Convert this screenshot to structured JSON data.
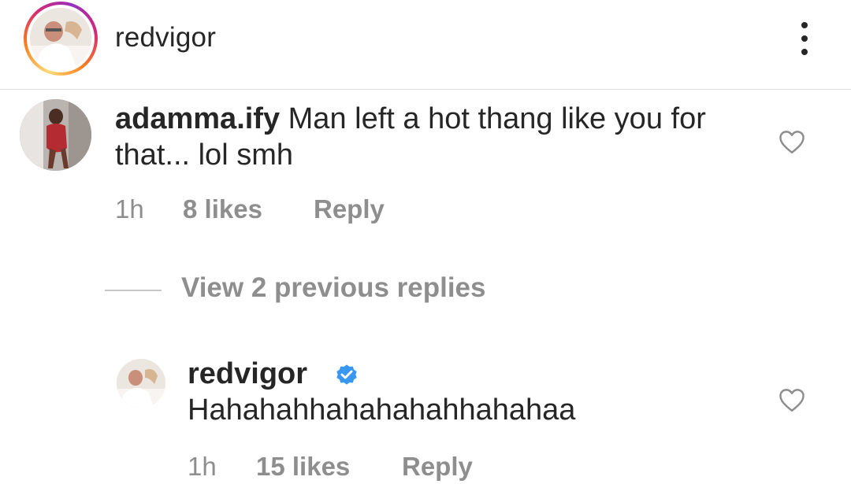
{
  "header": {
    "username": "redvigor"
  },
  "comment": {
    "username": "adamma.ify",
    "text": "Man left a hot thang like you for that... lol smh",
    "time": "1h",
    "likes": "8 likes",
    "reply_label": "Reply"
  },
  "replies_toggle": {
    "label": "View 2 previous replies"
  },
  "reply": {
    "username": "redvigor",
    "verified": true,
    "text": "Hahahahhahahahahhahahaa",
    "time": "1h",
    "likes": "15 likes",
    "reply_label": "Reply"
  },
  "colors": {
    "text": "#262626",
    "secondary": "#8e8e8e",
    "verified_blue": "#3897f0"
  }
}
